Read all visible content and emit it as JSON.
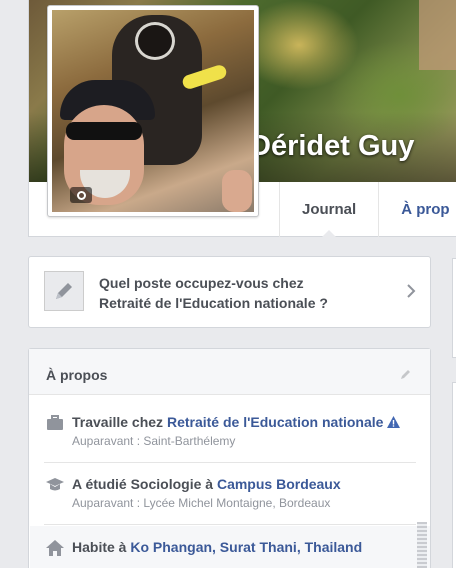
{
  "profile": {
    "name": "Déridet Guy"
  },
  "tabs": [
    {
      "label": "Journal"
    },
    {
      "label": "À prop"
    }
  ],
  "prompt": {
    "question_line1": "Quel poste occupez-vous chez",
    "question_line2": "Retraité de l'Education nationale ?"
  },
  "about": {
    "title": "À propos",
    "work": {
      "prefix": "Travaille chez ",
      "employer": "Retraité de l'Education nationale",
      "previous": "Auparavant : Saint-Barthélemy"
    },
    "education": {
      "prefix": "A étudié Sociologie à ",
      "school": "Campus Bordeaux",
      "previous": "Auparavant : Lycée Michel Montaigne, Bordeaux"
    },
    "home": {
      "prefix": "Habite à ",
      "place": "Ko Phangan, Surat Thani, Thailand"
    }
  },
  "icons": [
    "camera-icon",
    "pencil-icon",
    "chevron-right-icon",
    "edit-icon",
    "briefcase-icon",
    "warning-icon",
    "graduation-cap-icon",
    "house-icon"
  ],
  "colors": {
    "link": "#3b5998",
    "text": "#4b4f56",
    "muted": "#90949c",
    "warning": "#4267b2",
    "background": "#e9eaed"
  }
}
